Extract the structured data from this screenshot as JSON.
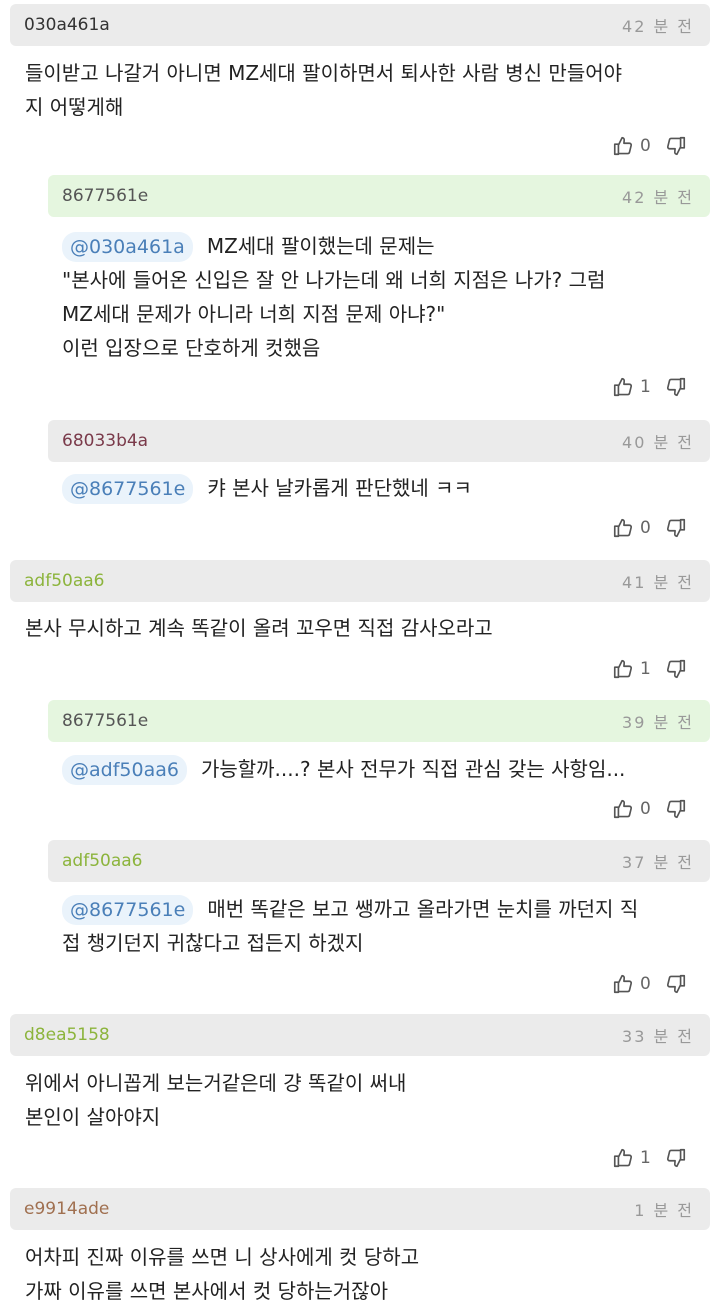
{
  "time_suffix": "분 전",
  "comments": [
    {
      "user": "030a461a",
      "time": "42 분 전",
      "mention": "",
      "text": "들이받고 나갈거 아니면 MZ세대 팔이하면서 퇴사한 사람 병신 만들어야\n지 어떻게해",
      "likes": "0",
      "user_color": "#333333"
    },
    {
      "user": "8677561e",
      "time": "42 분 전",
      "mention": "@030a461a",
      "text": "MZ세대 팔이했는데 문제는\n\"본사에 들어온 신입은 잘 안 나가는데 왜 너희 지점은 나가? 그럼\nMZ세대 문제가 아니라 너희 지점 문제 아냐?\"\n이런 입장으로 단호하게 컷했음",
      "likes": "1",
      "user_color": "#555555"
    },
    {
      "user": "68033b4a",
      "time": "40 분 전",
      "mention": "@8677561e",
      "text": "캬 본사 날카롭게 판단했네 ㅋㅋ",
      "likes": "0",
      "user_color": "#7a3a4a"
    },
    {
      "user": "adf50aa6",
      "time": "41 분 전",
      "mention": "",
      "text": "본사 무시하고 계속 똑같이 올려 꼬우면 직접 감사오라고",
      "likes": "1",
      "user_color": "#8cb43c"
    },
    {
      "user": "8677561e",
      "time": "39 분 전",
      "mention": "@adf50aa6",
      "text": "가능할까....? 본사 전무가 직접 관심 갖는 사항임...",
      "likes": "0",
      "user_color": "#555555"
    },
    {
      "user": "adf50aa6",
      "time": "37 분 전",
      "mention": "@8677561e",
      "text": "매번 똑같은 보고 쌩까고 올라가면 눈치를 까던지 직\n접 챙기던지 귀찮다고 접든지 하겠지",
      "likes": "0",
      "user_color": "#8cb43c"
    },
    {
      "user": "d8ea5158",
      "time": "33 분 전",
      "mention": "",
      "text": "위에서 아니꼽게 보는거같은데 걍 똑같이 써내\n본인이 살아야지",
      "likes": "1",
      "user_color": "#8cb43c"
    },
    {
      "user": "e9914ade",
      "time": "1 분 전",
      "mention": "",
      "text": "어차피 진짜 이유를 쓰면 니 상사에게 컷 당하고\n가짜 이유를 쓰면 본사에서 컷 당하는거잖아",
      "likes": "",
      "user_color": "#a07050"
    }
  ],
  "colors": {
    "header_gray": "#ebebeb",
    "header_green": "#e5f6df",
    "mention_bg": "#eaf3fb",
    "mention_text": "#4a7fb8"
  },
  "icons": {
    "like": "thumbs-up-icon",
    "dislike": "thumbs-down-icon"
  }
}
